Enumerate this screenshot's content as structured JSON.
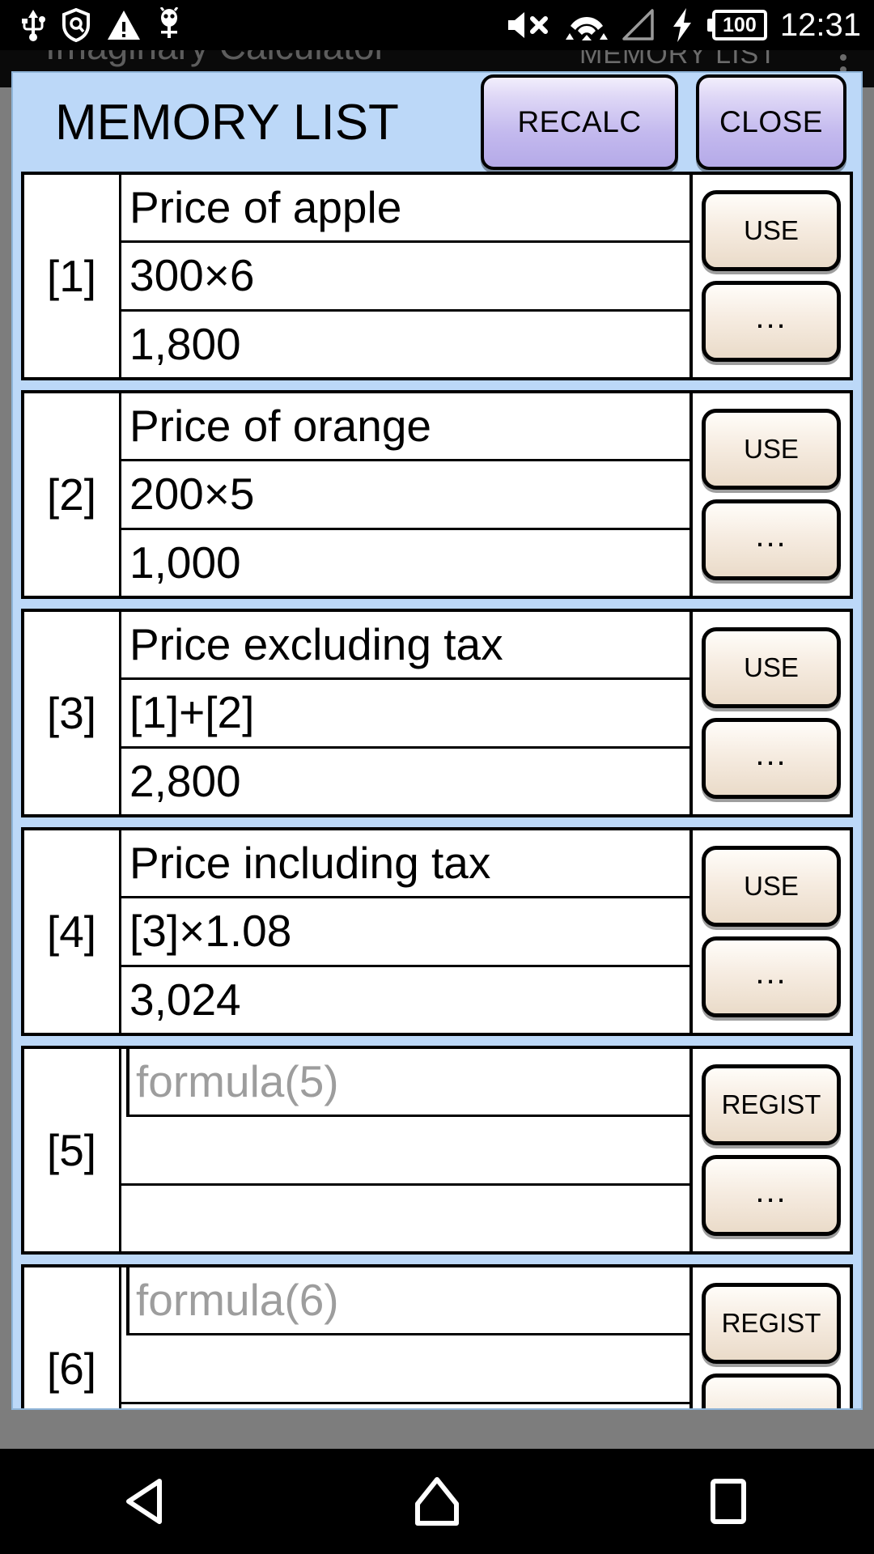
{
  "status_bar": {
    "time": "12:31",
    "battery_level": "100",
    "icons": [
      "usb-icon",
      "shield-icon",
      "warning-triangle-icon",
      "bug-icon",
      "mute-icon",
      "wifi-icon",
      "cell-signal-icon",
      "charging-bolt-icon",
      "battery-icon"
    ]
  },
  "background_app": {
    "title": "Imaginary Calculator",
    "subtitle": "MEMORY LIST",
    "overflow": "overflow-menu-icon"
  },
  "dialog": {
    "title": "MEMORY LIST",
    "recalc_label": "RECALC",
    "close_label": "CLOSE",
    "use_label": "USE",
    "regist_label": "REGIST",
    "more_label": "...",
    "rows": [
      {
        "index": "[1]",
        "name": "Price of apple",
        "formula": "300×6",
        "result": "1,800",
        "action": "USE",
        "placeholder": false
      },
      {
        "index": "[2]",
        "name": "Price of orange",
        "formula": "200×5",
        "result": "1,000",
        "action": "USE",
        "placeholder": false
      },
      {
        "index": "[3]",
        "name": "Price excluding tax",
        "formula": "[1]+[2]",
        "result": "2,800",
        "action": "USE",
        "placeholder": false
      },
      {
        "index": "[4]",
        "name": "Price including tax",
        "formula": "[3]×1.08",
        "result": "3,024",
        "action": "USE",
        "placeholder": false
      },
      {
        "index": "[5]",
        "name": "formula(5)",
        "formula": "",
        "result": "",
        "action": "REGIST",
        "placeholder": true
      },
      {
        "index": "[6]",
        "name": "formula(6)",
        "formula": "",
        "result": "",
        "action": "REGIST",
        "placeholder": true
      }
    ]
  },
  "nav_bar": {
    "back": "back-triangle-icon",
    "home": "home-pentagon-icon",
    "recents": "recents-square-icon"
  },
  "colors": {
    "dialog_bg": "#bcd8f8",
    "header_btn": "#c3b9ee",
    "action_btn": "#f6ece1",
    "scrim": "#7d7d7d",
    "placeholder_text": "#9d9d9d"
  }
}
